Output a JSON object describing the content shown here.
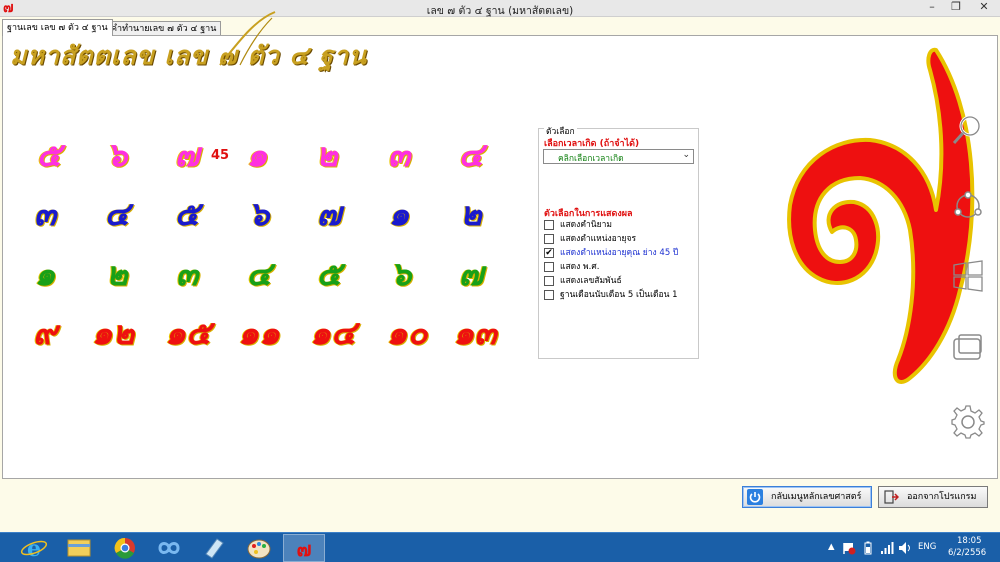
{
  "window": {
    "app_icon_glyph": "๗",
    "title": "เลข ๗ ตัว ๔ ฐาน (มหาสัตตเลข)",
    "controls": {
      "minimize": "–",
      "restore": "❐",
      "close": "✕"
    }
  },
  "tabs": [
    {
      "label": "ฐานเลข เลข ๗ ตัว ๔ ฐาน",
      "active": true
    },
    {
      "label": "คำทำนายเลข ๗ ตัว ๔ ฐาน",
      "active": false
    }
  ],
  "main": {
    "title": "มหาสัตตเลข เลข ๗ ตัว ๔ ฐาน",
    "age_marker": "45",
    "rows": [
      {
        "color": "#ff30e0",
        "values": [
          "๕",
          "๖",
          "๗",
          "๑",
          "๒",
          "๓",
          "๔"
        ]
      },
      {
        "color": "#1a1acd",
        "values": [
          "๓",
          "๔",
          "๕",
          "๖",
          "๗",
          "๑",
          "๒"
        ]
      },
      {
        "color": "#18a018",
        "values": [
          "๑",
          "๒",
          "๓",
          "๔",
          "๕",
          "๖",
          "๗"
        ]
      },
      {
        "color": "#ee1010",
        "values": [
          "๙",
          "๑๒",
          "๑๕",
          "๑๑",
          "๑๔",
          "๑๐",
          "๑๓"
        ]
      }
    ],
    "big_digit": "๗"
  },
  "options": {
    "group_label": "ตัวเลือก",
    "birth_time_label": "เลือกเวลาเกิด (ถ้าจำได้)",
    "birth_time_select": "คลิกเลือกเวลาเกิด",
    "display_options_label": "ตัวเลือกในการแสดงผล",
    "checkboxes": [
      {
        "label": "แสดงคำนิยาม",
        "checked": false
      },
      {
        "label": "แสดงตำแหน่งอายุจร",
        "checked": false
      },
      {
        "label": "แสดงตำแหน่งอายุคุณ ย่าง 45 ปี",
        "checked": true
      },
      {
        "label": "แสดง พ.ศ.",
        "checked": false
      },
      {
        "label": "แสดงเลขสัมพันธ์",
        "checked": false
      },
      {
        "label": "ฐานเดือนนับเดือน 5 เป็นเดือน 1",
        "checked": false
      }
    ],
    "check_glyph": "✔"
  },
  "buttons": {
    "back_label": "กลับเมนูหลักเลขศาสตร์",
    "exit_label": "ออกจากโปรแกรม"
  },
  "taskbar": {
    "lang": "ENG",
    "time": "18:05",
    "date": "6/2/2556",
    "tray_arrow": "▲",
    "items": [
      "ie",
      "file-explorer",
      "chrome",
      "infinity-app",
      "notepad",
      "paint",
      "numerology-app"
    ]
  },
  "colors": {
    "magenta": "#ff30e0",
    "blue": "#1a1acd",
    "green": "#18a018",
    "red": "#ee1010",
    "gold": "#c8a020",
    "taskbar": "#1a5fa8"
  }
}
